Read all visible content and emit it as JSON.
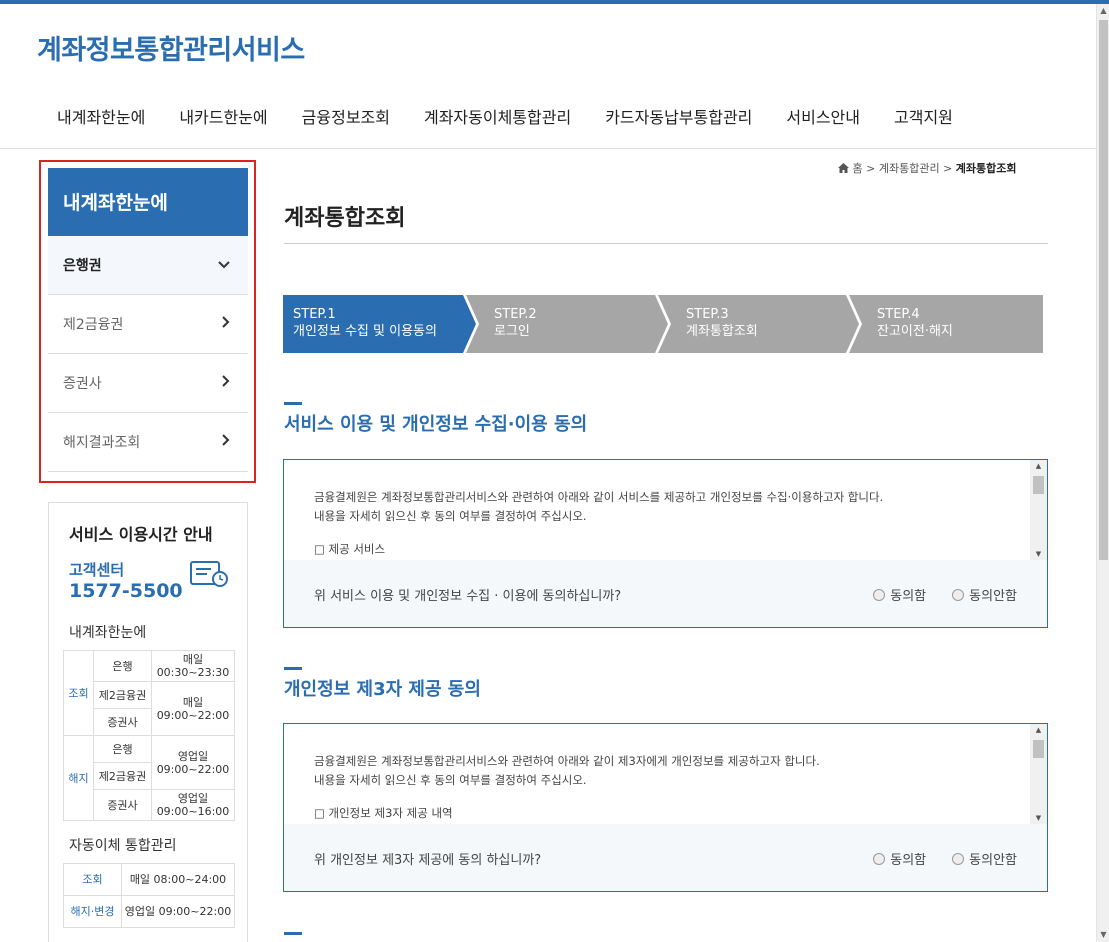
{
  "site": {
    "title": "계좌정보통합관리서비스"
  },
  "gnb": [
    "내계좌한눈에",
    "내카드한눈에",
    "금융정보조회",
    "계좌자동이체통합관리",
    "카드자동납부통합관리",
    "서비스안내",
    "고객지원"
  ],
  "lnb": {
    "header": "내계좌한눈에",
    "items": [
      {
        "label": "은행권",
        "icon": "chevron-down-icon"
      },
      {
        "label": "제2금융권",
        "icon": "chevron-right-icon"
      },
      {
        "label": "증권사",
        "icon": "chevron-right-icon"
      },
      {
        "label": "해지결과조회",
        "icon": "chevron-right-icon"
      }
    ]
  },
  "service_time": {
    "title": "서비스 이용시간 안내",
    "cs_label": "고객센터",
    "cs_number": "1577-5500",
    "section1": "내계좌한눈에",
    "rows1": [
      {
        "cat": "조회",
        "inst": "은행",
        "time": "매일\n00:30~23:30"
      },
      {
        "cat": "",
        "inst": "제2금융권",
        "time": "매일\n09:00~22:00"
      },
      {
        "cat": "",
        "inst": "증권사",
        "time": ""
      },
      {
        "cat": "해지",
        "inst": "은행",
        "time": "영업일\n09:00~22:00"
      },
      {
        "cat": "",
        "inst": "제2금융권",
        "time": ""
      },
      {
        "cat": "",
        "inst": "증권사",
        "time": "영업일\n09:00~16:00"
      }
    ],
    "section2": "자동이체 통합관리",
    "rows2": [
      {
        "cat": "조회",
        "time": "매일 08:00~24:00"
      },
      {
        "cat": "해지·변경",
        "time": "영업일 09:00~22:00"
      }
    ]
  },
  "breadcrumb": {
    "home": "홈",
    "level1": "계좌통합관리",
    "current": "계좌통합조회"
  },
  "page_title": "계좌통합조회",
  "steps": [
    {
      "num": "STEP.1",
      "label": "개인정보 수집 및 이용동의",
      "active": true
    },
    {
      "num": "STEP.2",
      "label": "로그인",
      "active": false
    },
    {
      "num": "STEP.3",
      "label": "계좌통합조회",
      "active": false
    },
    {
      "num": "STEP.4",
      "label": "잔고이전·해지",
      "active": false
    }
  ],
  "section1": {
    "title": "서비스 이용 및 개인정보 수집·이용 동의",
    "line1": "금융결제원은 계좌정보통합관리서비스와 관련하여 아래와 같이 서비스를 제공하고 개인정보를 수집·이용하고자 합니다.",
    "line2": "내용을 자세히 읽으신 후 동의 여부를 결정하여 주십시오.",
    "line3": "□ 제공 서비스",
    "question": "위 서비스 이용 및 개인정보 수집 · 이용에 동의하십니까?",
    "agree": "동의함",
    "disagree": "동의안함"
  },
  "section2": {
    "title": "개인정보 제3자 제공 동의",
    "line1": "금융결제원은 계좌정보통합관리서비스와 관련하여 아래와 같이 제3자에게 개인정보를 제공하고자 합니다.",
    "line2": "내용을 자세히 읽으신 후 동의 여부를 결정하여 주십시오.",
    "line3": "□ 개인정보 제3자 제공 내역",
    "question": "위 개인정보 제3자 제공에 동의 하십니까?",
    "agree": "동의함",
    "disagree": "동의안함"
  },
  "colors": {
    "primary": "#2a6db0",
    "step_inactive": "#a6a6a6",
    "highlight": "#d9251d"
  }
}
